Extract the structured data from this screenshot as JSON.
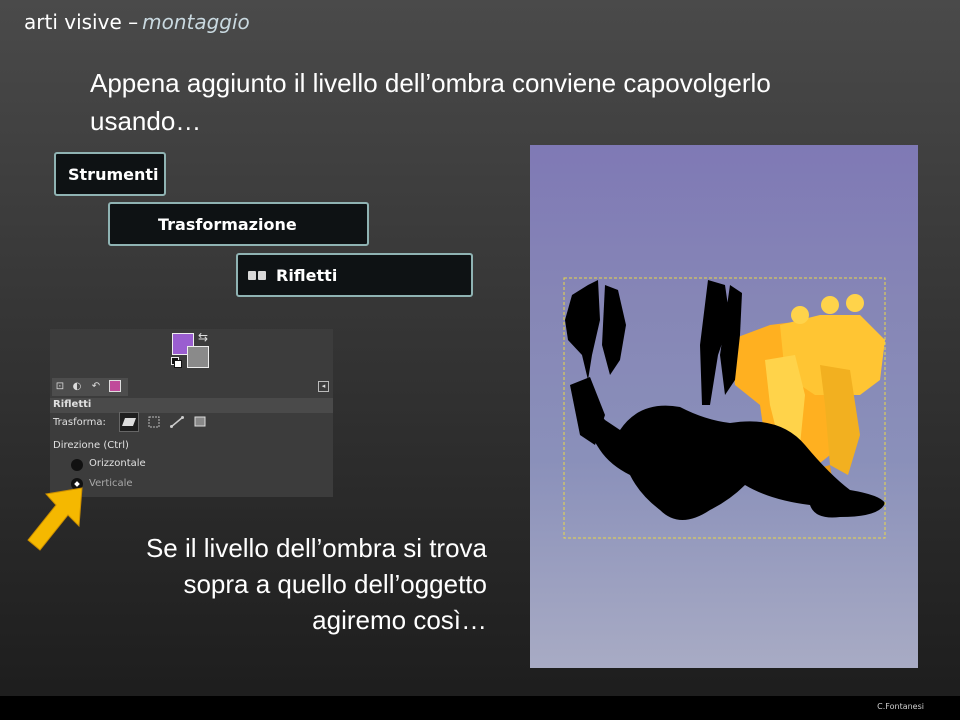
{
  "header": {
    "title": "arti visive –",
    "subtitle": "montaggio"
  },
  "intro_text": "Appena aggiunto il livello dell’ombra conviene capovolgerlo usando…",
  "menu_path": {
    "step1": "Strumenti",
    "step2": "Trasformazione",
    "step3": "Rifletti"
  },
  "tool_options": {
    "tool_name": "Rifletti",
    "transform_label": "Trasforma:",
    "direction_label": "Direzione  (Ctrl)",
    "options": [
      "Orizzontale",
      "Verticale"
    ],
    "selected_option": "Verticale",
    "colors": {
      "foreground": "#9a5ed0",
      "background": "#8a8a8a"
    }
  },
  "note_text": "Se il livello dell’ombra si trova sopra a quello dell’oggetto agiremo così…",
  "footer": {
    "author": "C.Fontanesi"
  },
  "colors": {
    "accent_arrow": "#f5b800",
    "crumb_border": "#8fb3b3",
    "selection_border": "#e8d84a"
  }
}
